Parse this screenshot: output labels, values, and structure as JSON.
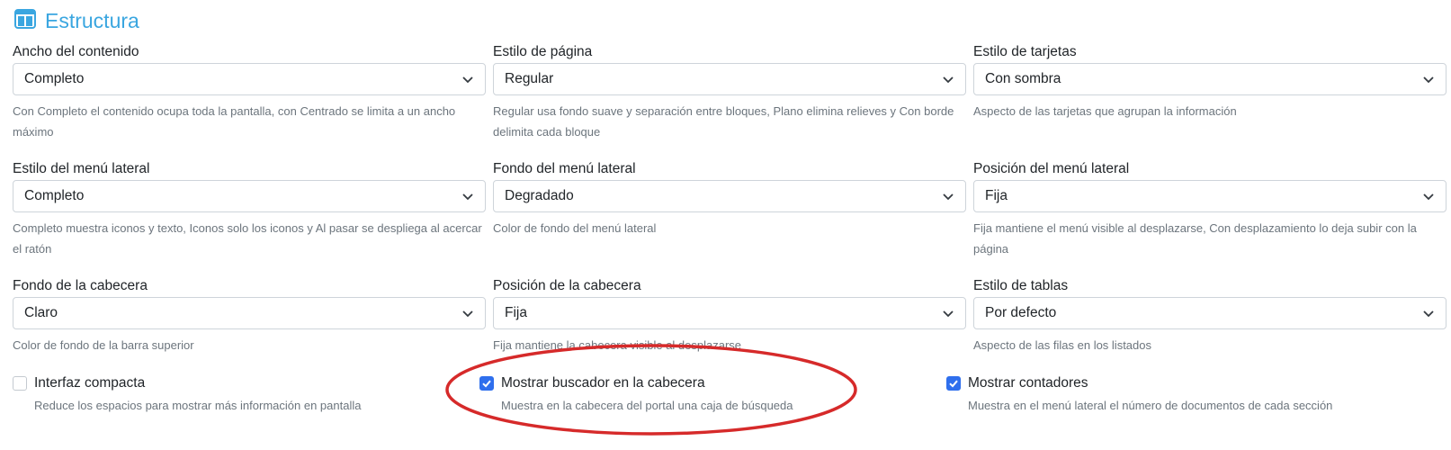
{
  "section": {
    "title": "Estructura",
    "icon": "layout-columns-icon"
  },
  "fields": [
    {
      "label": "Ancho del contenido",
      "value": "Completo",
      "help": "Con Completo el contenido ocupa toda la pantalla, con Centrado se limita a un ancho máximo"
    },
    {
      "label": "Estilo de página",
      "value": "Regular",
      "help": "Regular usa fondo suave y separación entre bloques, Plano elimina relieves y Con borde delimita cada bloque"
    },
    {
      "label": "Estilo de tarjetas",
      "value": "Con sombra",
      "help": "Aspecto de las tarjetas que agrupan la información"
    },
    {
      "label": "Estilo del menú lateral",
      "value": "Completo",
      "help": "Completo muestra iconos y texto, Iconos solo los iconos y Al pasar se despliega al acercar el ratón"
    },
    {
      "label": "Fondo del menú lateral",
      "value": "Degradado",
      "help": "Color de fondo del menú lateral"
    },
    {
      "label": "Posición del menú lateral",
      "value": "Fija",
      "help": "Fija mantiene el menú visible al desplazarse, Con desplazamiento lo deja subir con la página"
    },
    {
      "label": "Fondo de la cabecera",
      "value": "Claro",
      "help": "Color de fondo de la barra superior"
    },
    {
      "label": "Posición de la cabecera",
      "value": "Fija",
      "help": "Fija mantiene la cabecera visible al desplazarse"
    },
    {
      "label": "Estilo de tablas",
      "value": "Por defecto",
      "help": "Aspecto de las filas en los listados"
    }
  ],
  "checkboxes": [
    {
      "label": "Interfaz compacta",
      "checked": false,
      "help": "Reduce los espacios para mostrar más información en pantalla"
    },
    {
      "label": "Mostrar buscador en la cabecera",
      "checked": true,
      "help": "Muestra en la cabecera del portal una caja de búsqueda"
    },
    {
      "label": "Mostrar contadores",
      "checked": true,
      "help": "Muestra en el menú lateral el número de documentos de cada sección"
    }
  ],
  "colors": {
    "accent": "#3aa6e0",
    "checkbox_checked": "#2f6fed",
    "annotation": "#d62a2a"
  },
  "annotation": {
    "shape": "ellipse",
    "target": "checkboxes.1"
  }
}
